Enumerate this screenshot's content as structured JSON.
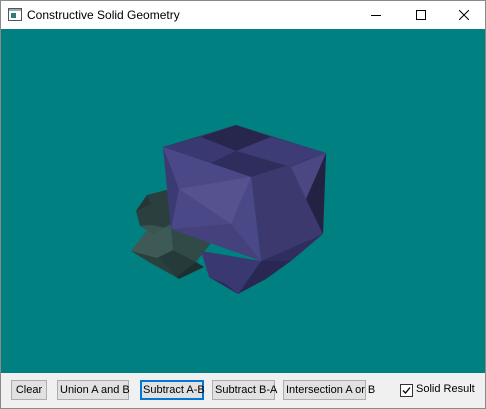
{
  "window": {
    "title": "Constructive Solid Geometry"
  },
  "viewport": {
    "background": "#008080",
    "shape_a_color": "#2f4a48",
    "shape_b_color": "#3a3866"
  },
  "toolbar": {
    "buttons": [
      {
        "label": "Clear"
      },
      {
        "label": "Union A and B"
      },
      {
        "label": "Subtract A-B"
      },
      {
        "label": "Subtract B-A"
      },
      {
        "label": "Intersection A or B"
      }
    ],
    "checkbox": {
      "label": "Solid Result",
      "checked": true
    }
  },
  "icons": {
    "app": "app-window-icon",
    "minimize": "minimize-icon",
    "maximize": "maximize-icon",
    "close": "close-icon",
    "check": "checkmark-icon"
  }
}
